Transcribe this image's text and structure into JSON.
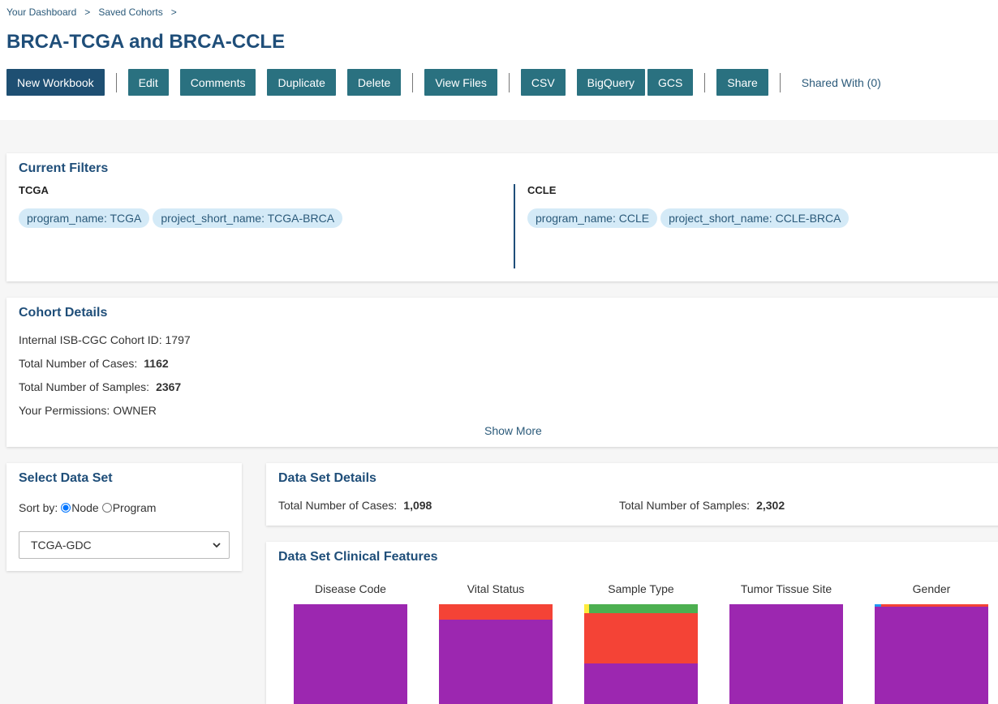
{
  "breadcrumb": {
    "item1": "Your Dashboard",
    "sep": ">",
    "item2": "Saved Cohorts"
  },
  "title": "BRCA-TCGA and BRCA-CCLE",
  "toolbar": {
    "new_workbook": "New Workbook",
    "edit": "Edit",
    "comments": "Comments",
    "duplicate": "Duplicate",
    "delete": "Delete",
    "view_files": "View Files",
    "csv": "CSV",
    "bigquery": "BigQuery",
    "gcs": "GCS",
    "share": "Share",
    "shared_with": "Shared With (0)"
  },
  "filters": {
    "heading": "Current Filters",
    "tcga": {
      "label": "TCGA",
      "chips": [
        "program_name: TCGA",
        "project_short_name: TCGA-BRCA"
      ]
    },
    "ccle": {
      "label": "CCLE",
      "chips": [
        "program_name: CCLE",
        "project_short_name: CCLE-BRCA"
      ]
    }
  },
  "cohort": {
    "heading": "Cohort Details",
    "id_label": "Internal ISB-CGC Cohort ID: 1797",
    "cases_label": "Total Number of Cases:",
    "cases_value": "1162",
    "samples_label": "Total Number of Samples:",
    "samples_value": "2367",
    "perm_label": "Your Permissions: OWNER",
    "show_more": "Show More"
  },
  "dataset_select": {
    "heading": "Select Data Set",
    "sort_label": "Sort by:",
    "opt_node": "Node",
    "opt_program": "Program",
    "selected": "TCGA-GDC"
  },
  "dataset_details": {
    "heading": "Data Set Details",
    "cases_label": "Total Number of Cases:",
    "cases_value": "1,098",
    "samples_label": "Total Number of Samples:",
    "samples_value": "2,302"
  },
  "clinical": {
    "heading": "Data Set Clinical Features",
    "charts": [
      "Disease Code",
      "Vital Status",
      "Sample Type",
      "Tumor Tissue Site",
      "Gender"
    ]
  },
  "colors": {
    "purple": "#9c27b0",
    "red": "#f44336",
    "green": "#4caf50",
    "yellow": "#ffeb3b",
    "blue": "#2196f3"
  }
}
